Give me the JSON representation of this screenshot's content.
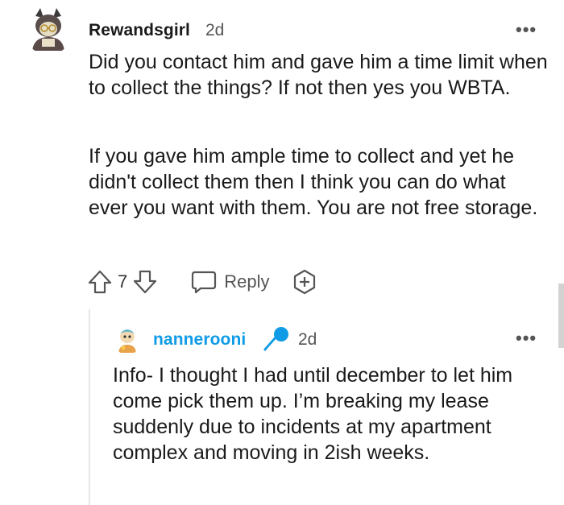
{
  "comment": {
    "username": "Rewandsgirl",
    "time": "2d",
    "more_label": "•••",
    "paragraphs": [
      "Did you contact him and gave him a time limit when to collect the things? If not then yes you WBTA.",
      "If you gave him ample time to collect and yet he didn't collect them then I think you can do what ever you want with them. You are not free storage."
    ],
    "actions": {
      "vote_count": "7",
      "reply_label": "Reply"
    }
  },
  "reply": {
    "username": "nannerooni",
    "time": "2d",
    "more_label": "•••",
    "text": "Info- I thought I had until december to let him come pick them up. I’m breaking my lease suddenly due to incidents at my apartment complex and moving in 2ish weeks."
  },
  "icons": {
    "upvote": "arrow-up-icon",
    "downvote": "arrow-down-icon",
    "reply": "speech-bubble-icon",
    "award": "plus-award-icon",
    "microphone": "microphone-icon",
    "more": "more-dots-icon"
  },
  "colors": {
    "reply_username": "#0f9be6",
    "text": "#1a1a1b",
    "muted": "#555555",
    "thread_line": "#e6e6e6"
  }
}
